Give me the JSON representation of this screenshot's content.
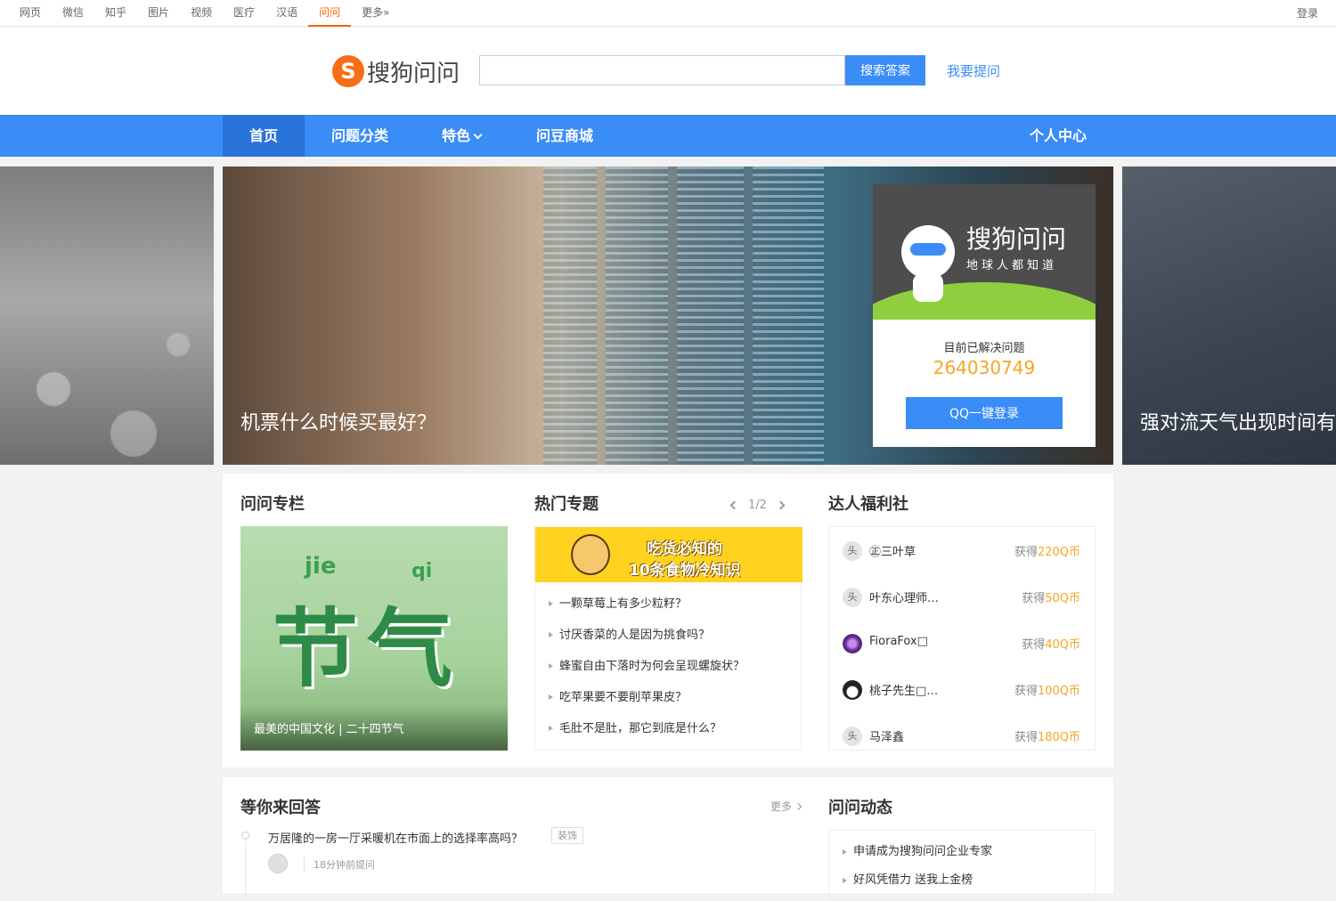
{
  "topbar": {
    "links": [
      "网页",
      "微信",
      "知乎",
      "图片",
      "视频",
      "医疗",
      "汉语",
      "问问",
      "更多»"
    ],
    "active_index": 7,
    "login": "登录"
  },
  "header": {
    "logo_mark": "S",
    "logo_text": "搜狗问问",
    "search_placeholder": "",
    "search_button": "搜索答案",
    "ask_link": "我要提问"
  },
  "nav": {
    "home": "首页",
    "categories": "问题分类",
    "features": "特色",
    "shop": "问豆商城",
    "personal": "个人中心"
  },
  "banner": {
    "main_caption": "机票什么时候买最好？",
    "right_caption": "强对流天气出现时间有"
  },
  "login_card": {
    "brand": "搜狗问问",
    "slogan": "地球人都知道",
    "solved_label": "目前已解决问题",
    "solved_count": "264030749",
    "qq_button": "QQ一键登录"
  },
  "column": {
    "title": "问问专栏",
    "image_pinyin_1": "jie",
    "image_pinyin_2": "qi",
    "image_big_text": "节气",
    "caption": "最美的中国文化 | 二十四节气"
  },
  "topics": {
    "title": "热门专题",
    "pager": "1/2",
    "banner_line1": "吃货必知的",
    "banner_line2": "10条食物冷知识",
    "items": [
      "一颗草莓上有多少粒籽？",
      "讨厌香菜的人是因为挑食吗？",
      "蜂蜜自由下落时为何会呈现螺旋状？",
      "吃苹果要不要削苹果皮？",
      "毛肚不是肚，那它到底是什么？"
    ]
  },
  "daren": {
    "title": "达人福利社",
    "gain_prefix": "获得",
    "rows": [
      {
        "avatar": "头",
        "name": "㊣三叶草",
        "coins": "220Q币",
        "style": "plain"
      },
      {
        "avatar": "头",
        "name": "叶东心理师…",
        "coins": "50Q币",
        "style": "plain"
      },
      {
        "avatar": "",
        "name": "FioraFox□",
        "coins": "40Q币",
        "style": "purple"
      },
      {
        "avatar": "",
        "name": "桃子先生□…",
        "coins": "100Q币",
        "style": "panda"
      },
      {
        "avatar": "头",
        "name": "马泽鑫",
        "coins": "180Q币",
        "style": "plain"
      }
    ]
  },
  "waiting": {
    "title": "等你来回答",
    "more": "更多",
    "question": "万居隆的一房一厅采暖机在市面上的选择率高吗？",
    "tag": "装饰",
    "time": "18分钟前提问"
  },
  "dynamics": {
    "title": "问问动态",
    "items": [
      "申请成为搜狗问问企业专家",
      "好风凭借力 送我上金榜"
    ]
  },
  "colors": {
    "accent_blue": "#3a8cf7",
    "nav_active": "#2a73d9",
    "brand_orange": "#fa6400",
    "coin_gold": "#f5a623"
  }
}
